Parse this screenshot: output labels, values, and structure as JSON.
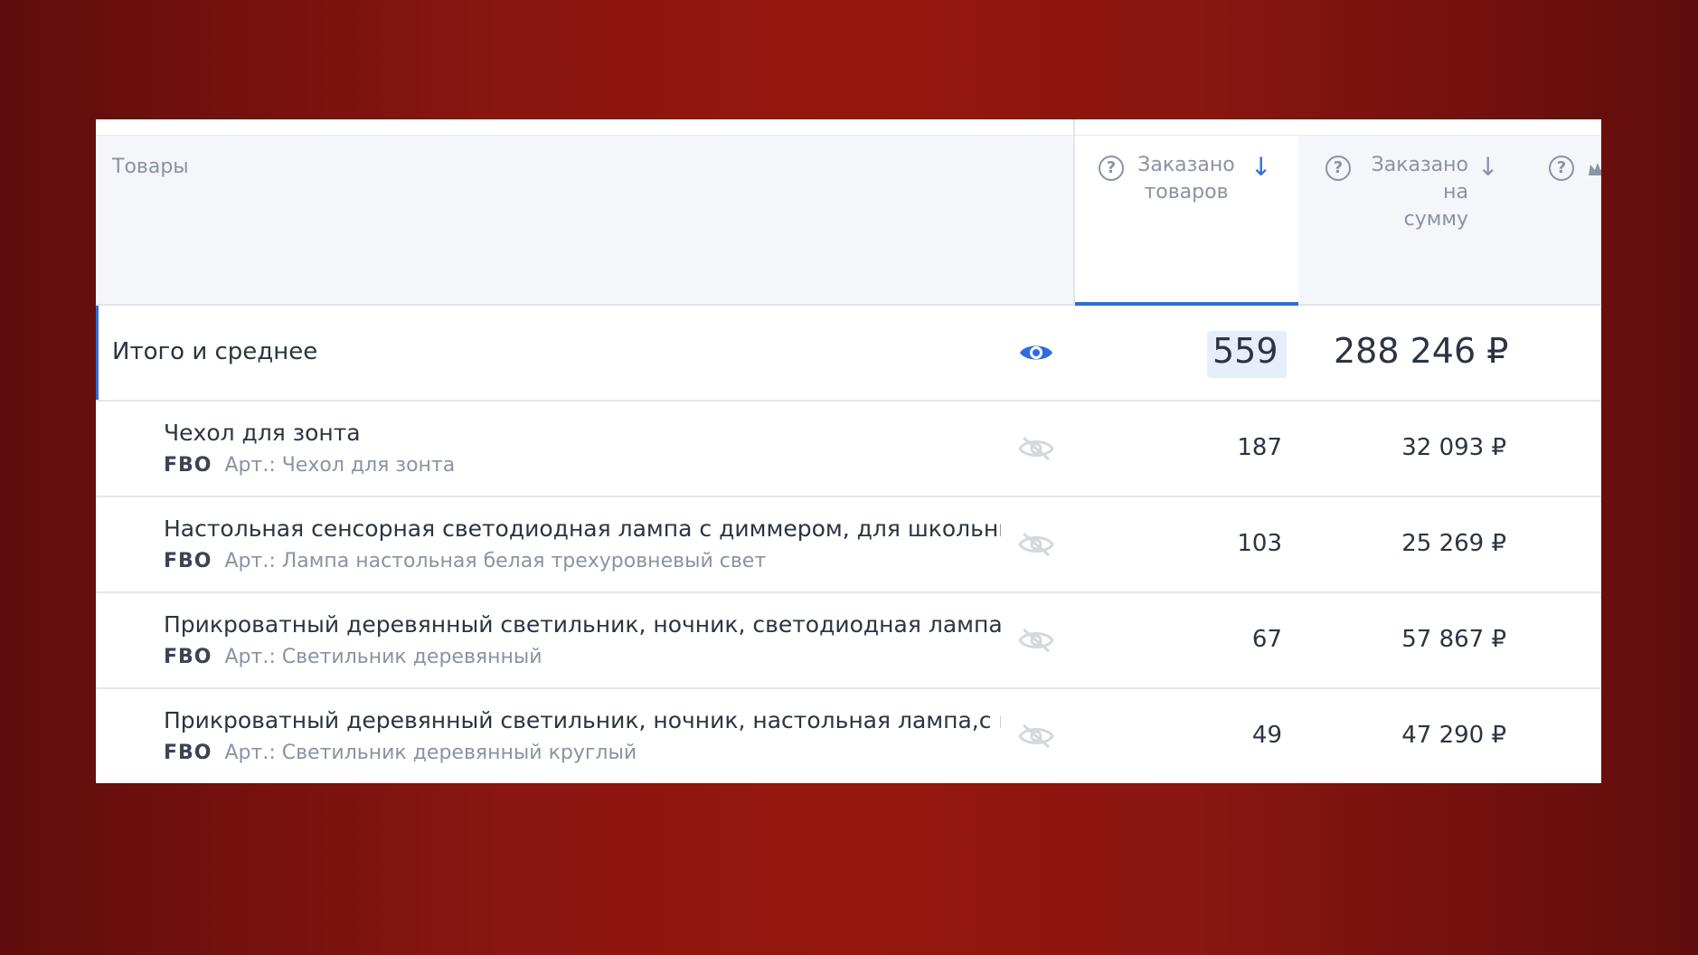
{
  "header": {
    "products_label": "Товары",
    "ordered_qty_label_1": "Заказано",
    "ordered_qty_label_2": "товаров",
    "ordered_sum_label_1": "Заказано",
    "ordered_sum_label_2": "на",
    "ordered_sum_label_3": "сумму",
    "help_glyph": "?",
    "sort_arrow": "↓"
  },
  "total": {
    "label": "Итого и среднее",
    "qty": "559",
    "sum": "288 246 ₽"
  },
  "rows": [
    {
      "name": "Чехол для зонта",
      "scheme": "FBO",
      "article": "Арт.: Чехол для зонта",
      "qty": "187",
      "sum": "32 093 ₽"
    },
    {
      "name": "Настольная сенсорная светодиодная лампа с диммером, для школьни",
      "scheme": "FBO",
      "article": "Арт.: Лампа настольная белая трехуровневый свет",
      "qty": "103",
      "sum": "25 269 ₽"
    },
    {
      "name": "Прикроватный деревянный светильник, ночник, светодиодная лампа",
      "scheme": "FBO",
      "article": "Арт.: Светильник деревянный",
      "qty": "67",
      "sum": "57 867 ₽"
    },
    {
      "name": "Прикроватный деревянный светильник, ночник, настольная лампа,с в",
      "scheme": "FBO",
      "article": "Арт.: Светильник деревянный круглый",
      "qty": "49",
      "sum": "47 290 ₽"
    }
  ],
  "colors": {
    "accent": "#2f6bdc",
    "muted_text": "#8a93a3",
    "primary_text": "#2c3442",
    "header_bg": "#f4f6f9",
    "hidden_eye": "#d3d7de"
  },
  "icons": {
    "visible": "eye-icon",
    "hidden": "eye-off-icon",
    "help": "question-circle-icon",
    "sort": "arrow-down-icon"
  }
}
